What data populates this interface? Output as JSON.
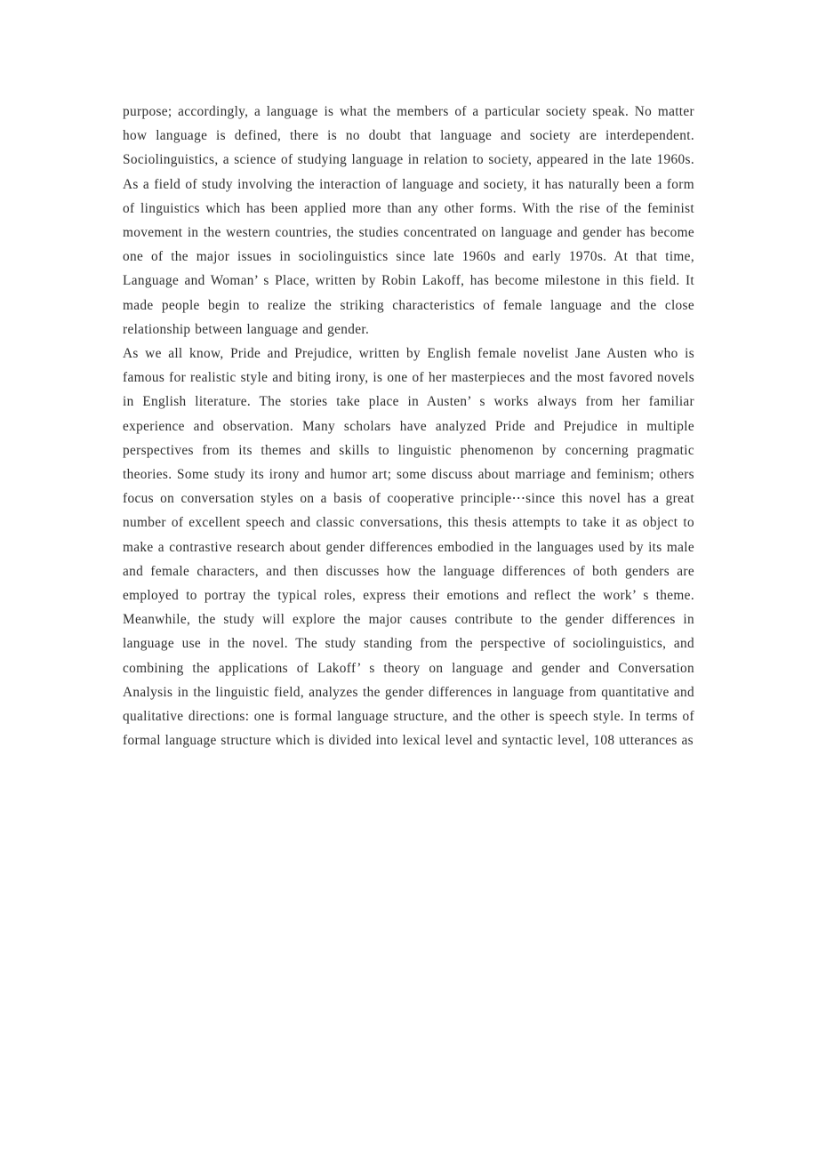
{
  "document": {
    "page_background": "#ffffff",
    "text_color": "#2e2e2e",
    "body": {
      "paragraphs": [
        {
          "id": "paragraph-1",
          "text": "purpose; accordingly, a language is what the members of a particular society speak. No matter how language is defined, there is no doubt that language and society are interdependent. Sociolinguistics, a science of studying language in relation to society, appeared in the late 1960s. As a field of study involving the interaction of language and society, it has naturally been a form of linguistics which has been applied more than any other forms. With the rise of the feminist movement in the western countries, the studies concentrated on language and gender has become one of the major issues in sociolinguistics since late 1960s and early 1970s. At that time, Language and Woman’ s Place, written by Robin Lakoff, has become milestone in this field. It made people begin to realize the striking characteristics of female language and the close relationship between language and gender."
        },
        {
          "id": "paragraph-2",
          "text": "As we all know, Pride and Prejudice, written by English female novelist Jane Austen who is famous for realistic style and biting irony, is one of her masterpieces and the most favored novels in English literature. The stories take place in Austen’ s works always from her familiar experience and observation. Many scholars have analyzed Pride and Prejudice in multiple perspectives from its themes and skills to linguistic phenomenon by concerning pragmatic theories. Some study its irony and humor art; some discuss about marriage and feminism; others focus on conversation styles on a basis of cooperative principle⋯since this novel has a great number of excellent speech and classic conversations, this thesis attempts to take it as object to make a contrastive research about gender differences embodied in the languages used by its male and female characters, and then discusses how the language differences of both genders are employed to portray the typical roles, express their emotions and reflect the work’ s theme. Meanwhile, the study will explore the major causes contribute to the gender differences in language use in the novel. The study standing from the perspective of sociolinguistics, and combining the applications of Lakoff’ s theory on language and gender and Conversation Analysis in the linguistic field, analyzes the gender differences in language from quantitative and qualitative directions: one is formal language structure, and the other is speech style. In terms of formal language structure which is divided into lexical level and syntactic level, 108 utterances as"
        }
      ]
    }
  }
}
